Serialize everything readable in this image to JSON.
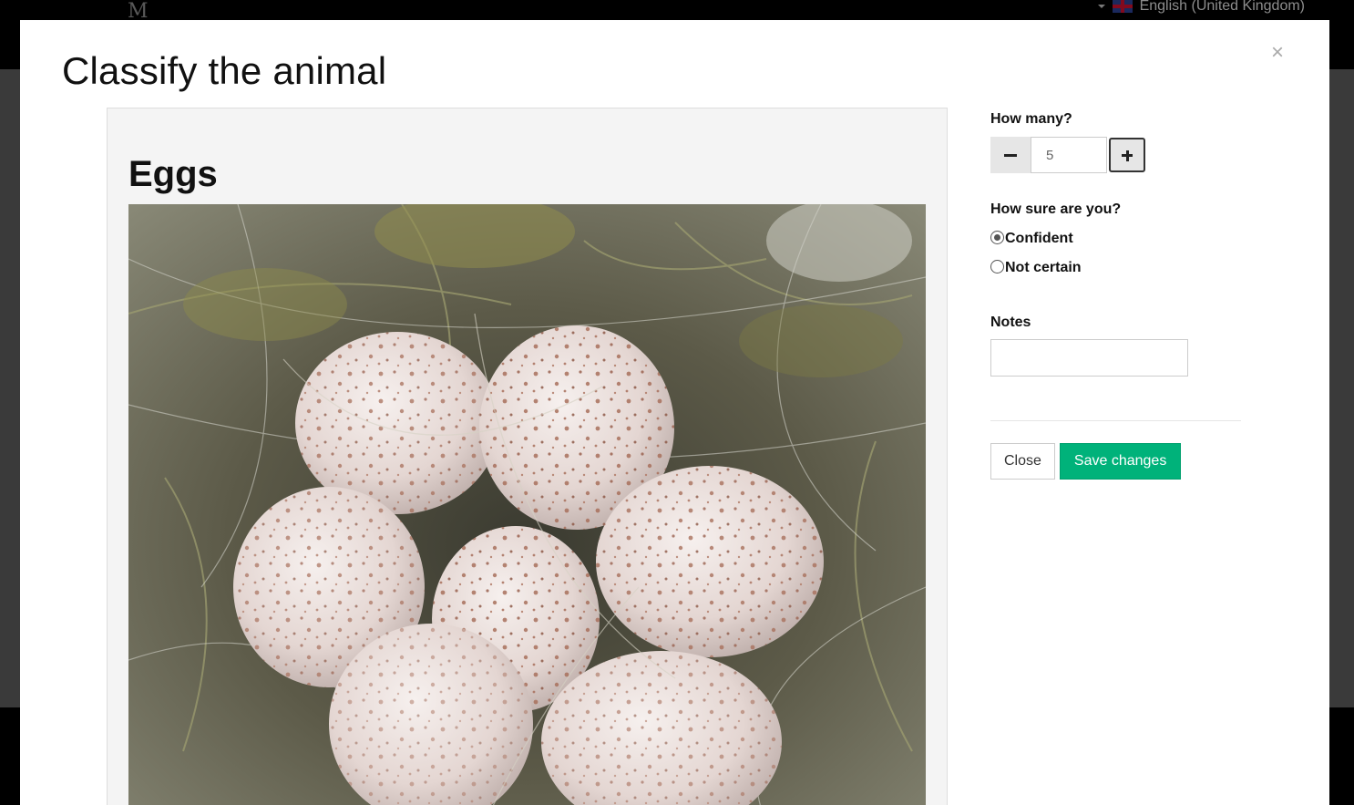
{
  "page": {
    "language_label": "English (United Kingdom)"
  },
  "modal": {
    "title": "Classify the animal",
    "close_symbol": "×",
    "panel_title": "Eggs",
    "photo_alt": "Eggs"
  },
  "form": {
    "how_many_label": "How many?",
    "count_value": "5",
    "how_sure_label": "How sure are you?",
    "options": [
      {
        "label": "Confident",
        "checked": true
      },
      {
        "label": "Not certain",
        "checked": false
      }
    ],
    "notes_label": "Notes",
    "notes_value": "",
    "close_button": "Close",
    "save_button": "Save changes"
  },
  "colors": {
    "save_button": "#00b27a",
    "topbar": "#000000"
  },
  "icons": [
    "minus-icon",
    "plus-icon",
    "close-icon",
    "caret-down-icon",
    "uk-flag-icon"
  ]
}
